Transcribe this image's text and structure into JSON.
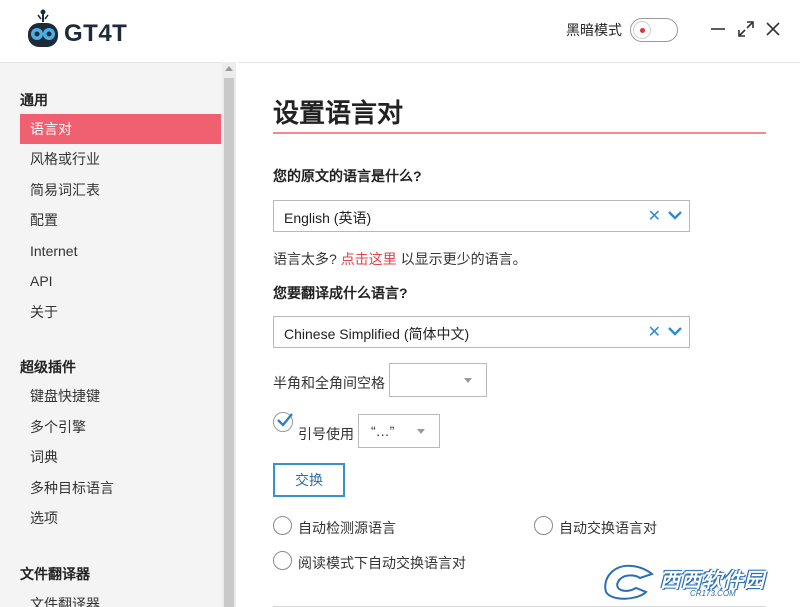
{
  "app": {
    "name": "GT4T"
  },
  "titlebar": {
    "dark_mode_label": "黑暗模式"
  },
  "sidebar": {
    "sections": [
      {
        "title": "通用",
        "items": [
          "语言对",
          "风格或行业",
          "简易词汇表",
          "配置",
          "Internet",
          "API",
          "关于"
        ]
      },
      {
        "title": "超级插件",
        "items": [
          "键盘快捷键",
          "多个引擎",
          "词典",
          "多种目标语言",
          "选项"
        ]
      },
      {
        "title": "文件翻译器",
        "items": [
          "文件翻译器"
        ]
      }
    ],
    "active_item": "语言对"
  },
  "main": {
    "title": "设置语言对",
    "source_question": "您的原文的语言是什么?",
    "source_value": "English (英语)",
    "hint_prefix": "语言太多?",
    "hint_link": "点击这里",
    "hint_suffix": "以显示更少的语言。",
    "target_question": "您要翻译成什么语言?",
    "target_value": "Chinese Simplified (简体中文)",
    "spacing_label": "半角和全角间空格",
    "spacing_value": "",
    "quotes_label": "引号使用",
    "quotes_value": "“…”",
    "swap_button": "交换",
    "radio_auto_detect": "自动检测源语言",
    "radio_auto_swap": "自动交换语言对",
    "radio_reading_mode": "阅读模式下自动交换语言对"
  },
  "watermark": {
    "text": "西西软件园",
    "sub": "CR173.COM"
  },
  "colors": {
    "accent": "#f16070",
    "link": "#e0444e",
    "blue": "#2e8bd6"
  }
}
